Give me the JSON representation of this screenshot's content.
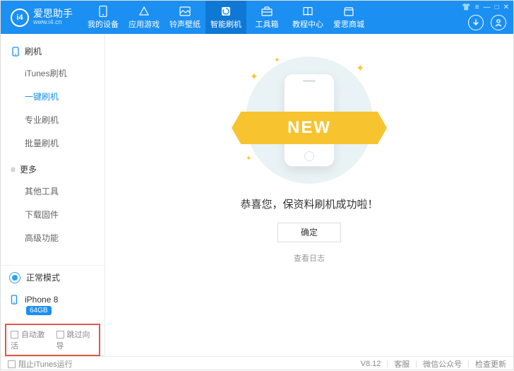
{
  "brand": {
    "title": "爱思助手",
    "sub": "www.i4.cn",
    "badge": "i4"
  },
  "nav": [
    {
      "label": "我的设备"
    },
    {
      "label": "应用游戏"
    },
    {
      "label": "铃声壁纸"
    },
    {
      "label": "智能刷机"
    },
    {
      "label": "工具箱"
    },
    {
      "label": "教程中心"
    },
    {
      "label": "爱思商城"
    }
  ],
  "sidebar": {
    "section1": {
      "title": "刷机",
      "items": [
        "iTunes刷机",
        "一键刷机",
        "专业刷机",
        "批量刷机"
      ],
      "active_index": 1
    },
    "section2": {
      "title": "更多",
      "items": [
        "其他工具",
        "下载固件",
        "高级功能"
      ]
    },
    "mode_label": "正常模式",
    "device_name": "iPhone 8",
    "device_storage": "64GB",
    "check_auto_activate": "自动激活",
    "check_skip_guide": "跳过向导"
  },
  "main": {
    "ribbon": "NEW",
    "success_text": "恭喜您，保资料刷机成功啦！",
    "ok_label": "确定",
    "log_label": "查看日志"
  },
  "footer": {
    "block_itunes": "阻止iTunes运行",
    "version": "V8.12",
    "support": "客服",
    "wechat": "微信公众号",
    "update": "检查更新"
  }
}
